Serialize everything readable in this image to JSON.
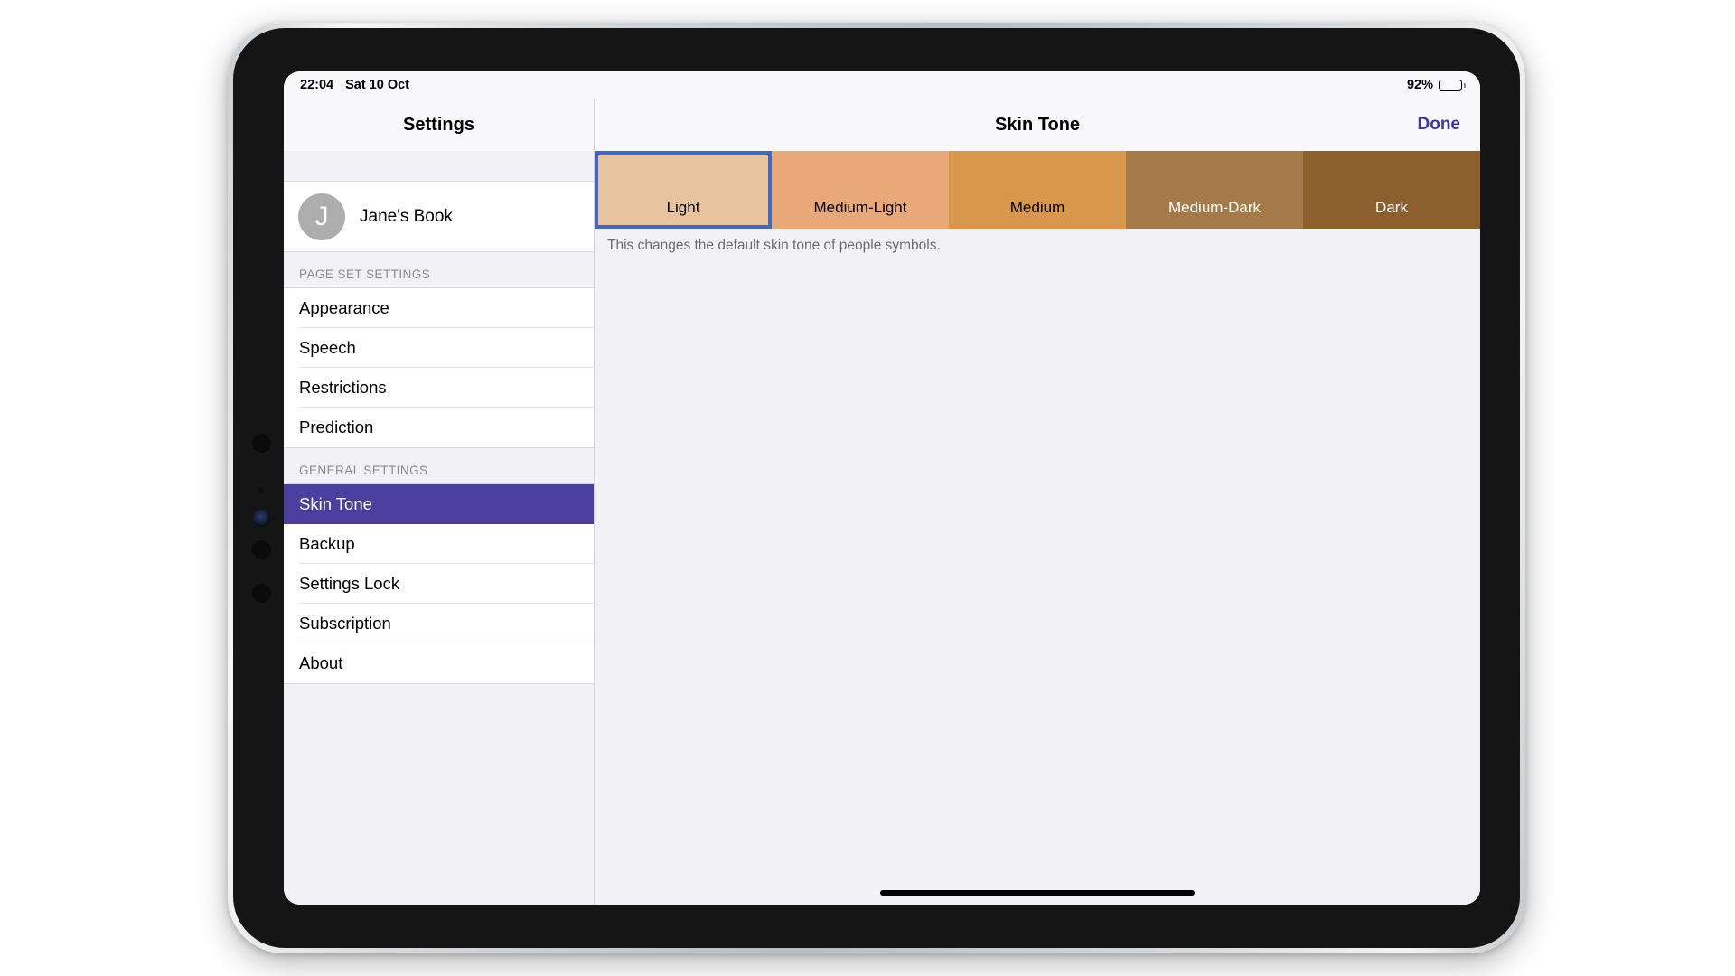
{
  "status_bar": {
    "time": "22:04",
    "date": "Sat 10 Oct",
    "battery_percent": "92%",
    "battery_level": 92
  },
  "sidebar": {
    "title": "Settings",
    "account": {
      "avatar_initial": "J",
      "name": "Jane's Book"
    },
    "sections": [
      {
        "header": "PAGE SET SETTINGS",
        "items": [
          {
            "label": "Appearance",
            "selected": false
          },
          {
            "label": "Speech",
            "selected": false
          },
          {
            "label": "Restrictions",
            "selected": false
          },
          {
            "label": "Prediction",
            "selected": false
          }
        ]
      },
      {
        "header": "GENERAL SETTINGS",
        "items": [
          {
            "label": "Skin Tone",
            "selected": true
          },
          {
            "label": "Backup",
            "selected": false
          },
          {
            "label": "Settings Lock",
            "selected": false
          },
          {
            "label": "Subscription",
            "selected": false
          },
          {
            "label": "About",
            "selected": false
          }
        ]
      }
    ]
  },
  "detail": {
    "title": "Skin Tone",
    "done_label": "Done",
    "footnote": "This changes the default skin tone of people symbols.",
    "selected_tone": "Light",
    "tones": [
      {
        "label": "Light",
        "color": "#e8c49e",
        "text_light": false,
        "selected": true
      },
      {
        "label": "Medium-Light",
        "color": "#e9a878",
        "text_light": false,
        "selected": false
      },
      {
        "label": "Medium",
        "color": "#d9974b",
        "text_light": false,
        "selected": false
      },
      {
        "label": "Medium-Dark",
        "color": "#a37a48",
        "text_light": true,
        "selected": false
      },
      {
        "label": "Dark",
        "color": "#8d5f2d",
        "text_light": true,
        "selected": false
      }
    ]
  },
  "colors": {
    "accent": "#3c37a8",
    "selected_row": "#4a3f9e",
    "selection_border": "#4169c4"
  }
}
